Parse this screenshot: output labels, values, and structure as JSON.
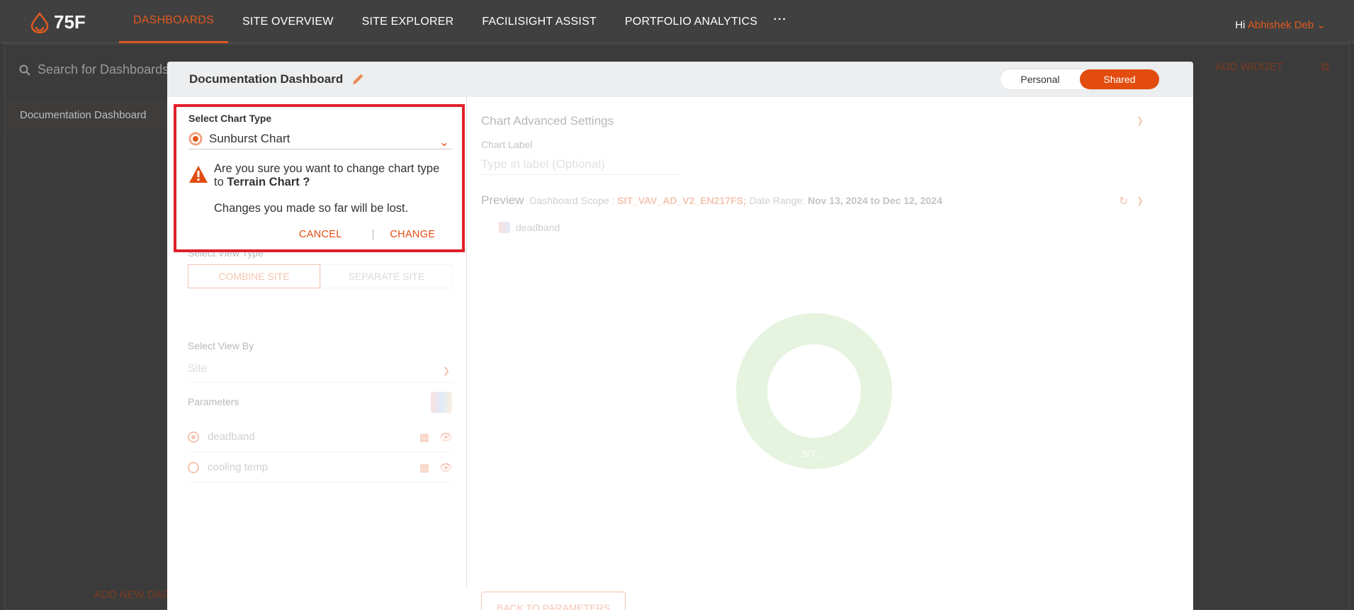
{
  "nav": {
    "logo_text": "75F",
    "items": [
      {
        "label": "DASHBOARDS",
        "active": true
      },
      {
        "label": "SITE OVERVIEW"
      },
      {
        "label": "SITE EXPLORER"
      },
      {
        "label": "FACILISIGHT ASSIST"
      },
      {
        "label": "PORTFOLIO ANALYTICS"
      }
    ],
    "more": "···",
    "greeting": "Hi",
    "user_name": "Abhishek Deb"
  },
  "background": {
    "search_placeholder": "Search for Dashboards",
    "sidebar_item": "Documentation Dashboard",
    "add_widget": "ADD WIDGET",
    "add_new_dashboard": "ADD NEW DAS"
  },
  "modal": {
    "title": "Documentation Dashboard",
    "toggle": {
      "personal": "Personal",
      "shared": "Shared",
      "selected": "Shared"
    },
    "left": {
      "select_chart_type_label": "Select Chart Type",
      "selected_chart": "Sunburst Chart",
      "warning_line1": "Are you sure you want to change chart type to ",
      "warning_target": "Terrain Chart ?",
      "warning_line2": "Changes you made so far will be lost.",
      "cancel": "CANCEL",
      "separator": "|",
      "change": "CHANGE",
      "view_type_label": "Select View Type",
      "view_type_options": [
        "COMBINE SITE",
        "SEPARATE SITE"
      ],
      "view_by_label": "Select View By",
      "view_by_value": "Site",
      "parameters_label": "Parameters",
      "parameters": [
        {
          "name": "deadband",
          "selected": true
        },
        {
          "name": "cooling temp",
          "selected": false
        }
      ]
    },
    "right": {
      "advanced_settings": "Chart Advanced Settings",
      "chart_label_label": "Chart Label",
      "chart_label_placeholder": "Type in label (Optional)",
      "preview": "Preview",
      "scope_label": "Dashboard Scope :",
      "scope_value": "SIT_VAV_AD_V2_EN217FS;",
      "date_label": "Date Range:",
      "date_value": "Nov 13, 2024 to Dec 12, 2024",
      "legend_item": "deadband",
      "donut_label": "SIT_..",
      "back_button": "BACK TO PARAMETERS"
    }
  }
}
